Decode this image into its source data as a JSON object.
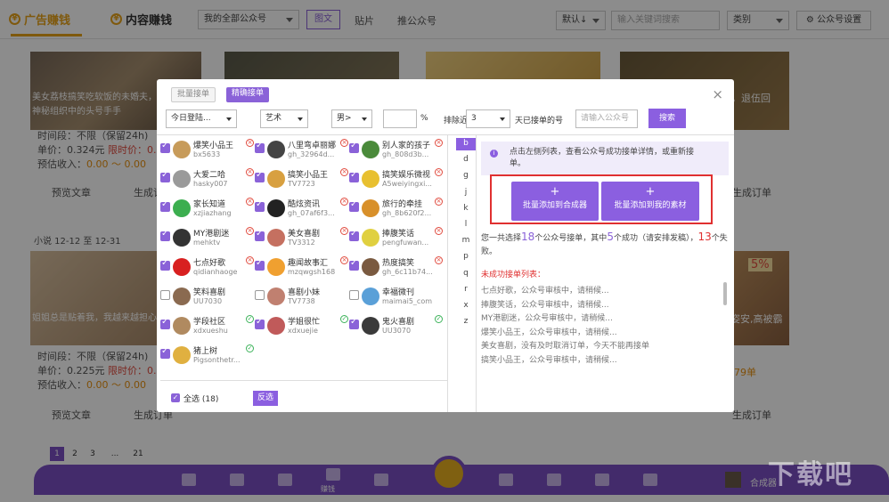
{
  "top": {
    "tab_ad": "广告赚钱",
    "tab_content": "内容赚钱",
    "account_select": "我的全部公众号",
    "btn_image": "图文",
    "btn_sticker": "贴片",
    "btn_promote": "推公众号",
    "sort": "默认↓",
    "search_placeholder": "输入关键词搜索",
    "category": "类别",
    "settings": "公众号设置"
  },
  "cards": [
    {
      "title": "美女荔枝搞笑吃软饭的未婚夫，和知他是神秘组织中的头号手手",
      "time": "时间段：不限（保留24h)",
      "price_label": "单价：0.324元",
      "price_extra": "限时价：0.324",
      "income_label": "预估收入：",
      "income": "0.00 ～ 0.00",
      "preview": "预览文章",
      "generate": "生成订单"
    },
    {
      "title": "姐姐总是贴着我，我越来越担心我住...",
      "time": "时间段：不限（保留24h)",
      "price_label": "单价：0.225元",
      "price_extra": "限时价：0.225",
      "income_label": "预估收入：",
      "income": "0.00 ～ 0.00",
      "preview": "预览文章",
      "generate": "生成订单"
    }
  ],
  "card_right_title1": "大，退伍回",
  "card_right_title2": "姿安,高被霸",
  "section_label": "小说 12-12 至 12-31",
  "bg_preview": "预览文章",
  "bg_generate": "生成订单",
  "bg_price": "79单",
  "bg_discount": "5%",
  "pagination": [
    "1",
    "2",
    "3",
    "...",
    "21"
  ],
  "bottom": {
    "label": "赚钱",
    "combine": "合成器"
  },
  "modal": {
    "tab_batch": "批量接单",
    "tab_precise": "精确接单",
    "filter_date": "今日登陆...",
    "filter_category": "艺术",
    "filter_gender": "男>",
    "percent_unit": "%",
    "exclude_label": "排除近",
    "exclude_days": "3",
    "exclude_suffix": "天已接单的号",
    "account_placeholder": "请输入公众号",
    "search_btn": "搜索",
    "accounts": [
      {
        "name": "爆笑小品王",
        "id": "bx5633",
        "checked": true,
        "status": "x",
        "color": "#c79b5a"
      },
      {
        "name": "八里弯卓丽娜",
        "id": "gh_32964d...",
        "checked": true,
        "status": "x",
        "color": "#444"
      },
      {
        "name": "别人家的孩子",
        "id": "gh_808d3b...",
        "checked": true,
        "status": "x",
        "color": "#4a8a3a"
      },
      {
        "name": "大爱二哈",
        "id": "hasky007",
        "checked": true,
        "status": "x",
        "color": "#9a9a9a"
      },
      {
        "name": "搞笑小品王",
        "id": "TV7723",
        "checked": true,
        "status": "x",
        "color": "#d8a040"
      },
      {
        "name": "搞笑娱乐微视",
        "id": "A5weiyingxi...",
        "checked": true,
        "status": "x",
        "color": "#e8c030"
      },
      {
        "name": "家长知道",
        "id": "xzjiazhang",
        "checked": true,
        "status": "x",
        "color": "#3cae4f"
      },
      {
        "name": "酷炫资讯",
        "id": "gh_07af6f3...",
        "checked": true,
        "status": "x",
        "color": "#222"
      },
      {
        "name": "旅行的牵挂",
        "id": "gh_8b620f2...",
        "checked": true,
        "status": "x",
        "color": "#d8902a"
      },
      {
        "name": "MY港剧迷",
        "id": "mehktv",
        "checked": true,
        "status": "x",
        "color": "#333"
      },
      {
        "name": "美女喜剧",
        "id": "TV3312",
        "checked": true,
        "status": "x",
        "color": "#c57060"
      },
      {
        "name": "捧腹笑话",
        "id": "pengfuwan...",
        "checked": true,
        "status": "x",
        "color": "#e0d040"
      },
      {
        "name": "七点好歌",
        "id": "qidianhaoge",
        "checked": true,
        "status": "x",
        "color": "#d82020"
      },
      {
        "name": "趣闻故事汇",
        "id": "mzqwgsh168",
        "checked": true,
        "status": "x",
        "color": "#f0a030"
      },
      {
        "name": "热度搞笑",
        "id": "gh_6c11b74...",
        "checked": true,
        "status": "x",
        "color": "#7a5a40"
      },
      {
        "name": "笑料喜剧",
        "id": "UU7030",
        "checked": false,
        "status": "",
        "color": "#8a6a50"
      },
      {
        "name": "喜剧小妹",
        "id": "TV7738",
        "checked": false,
        "status": "",
        "color": "#c08070"
      },
      {
        "name": "幸福微刊",
        "id": "maimai5_com",
        "checked": false,
        "status": "",
        "color": "#5aa0d8"
      },
      {
        "name": "学段社区",
        "id": "xdxueshu",
        "checked": true,
        "status": "ok",
        "color": "#b08a60"
      },
      {
        "name": "学姐很忙",
        "id": "xdxuejie",
        "checked": true,
        "status": "ok",
        "color": "#c05a5a"
      },
      {
        "name": "鬼火喜剧",
        "id": "UU3070",
        "checked": true,
        "status": "ok",
        "color": "#3a3a3a"
      },
      {
        "name": "猪上树",
        "id": "Pigsonthetr...",
        "checked": true,
        "status": "ok",
        "color": "#e0b040"
      }
    ],
    "select_all": "全选 (18)",
    "invert": "反选",
    "letters": [
      "b",
      "d",
      "g",
      "j",
      "k",
      "l",
      "m",
      "p",
      "q",
      "r",
      "x",
      "z"
    ],
    "info": "点击左侧列表，查看公众号成功接单详情，或重新接单。",
    "btn_add_combiner": "批量添加到合成器",
    "btn_add_material": "批量添加到我的素材",
    "summary_pre": "您一共选择",
    "summary_total": "18",
    "summary_mid1": "个公众号接单，其中",
    "summary_success": "5",
    "summary_mid2": "个成功（请安排发稿），",
    "summary_fail": "13",
    "summary_post": "个失败。",
    "fail_title": "未成功接单列表：",
    "fail_list": [
      "七点好歌，公众号审核中，请稍候...",
      "捧腹笑话，公众号审核中，请稍候...",
      "MY港剧迷，公众号审核中，请稍候...",
      "爆笑小品王，公众号审核中，请稍候...",
      "美女喜剧，没有及时取消订单，今天不能再接单",
      "搞笑小品王，公众号审核中，请稍候..."
    ]
  }
}
